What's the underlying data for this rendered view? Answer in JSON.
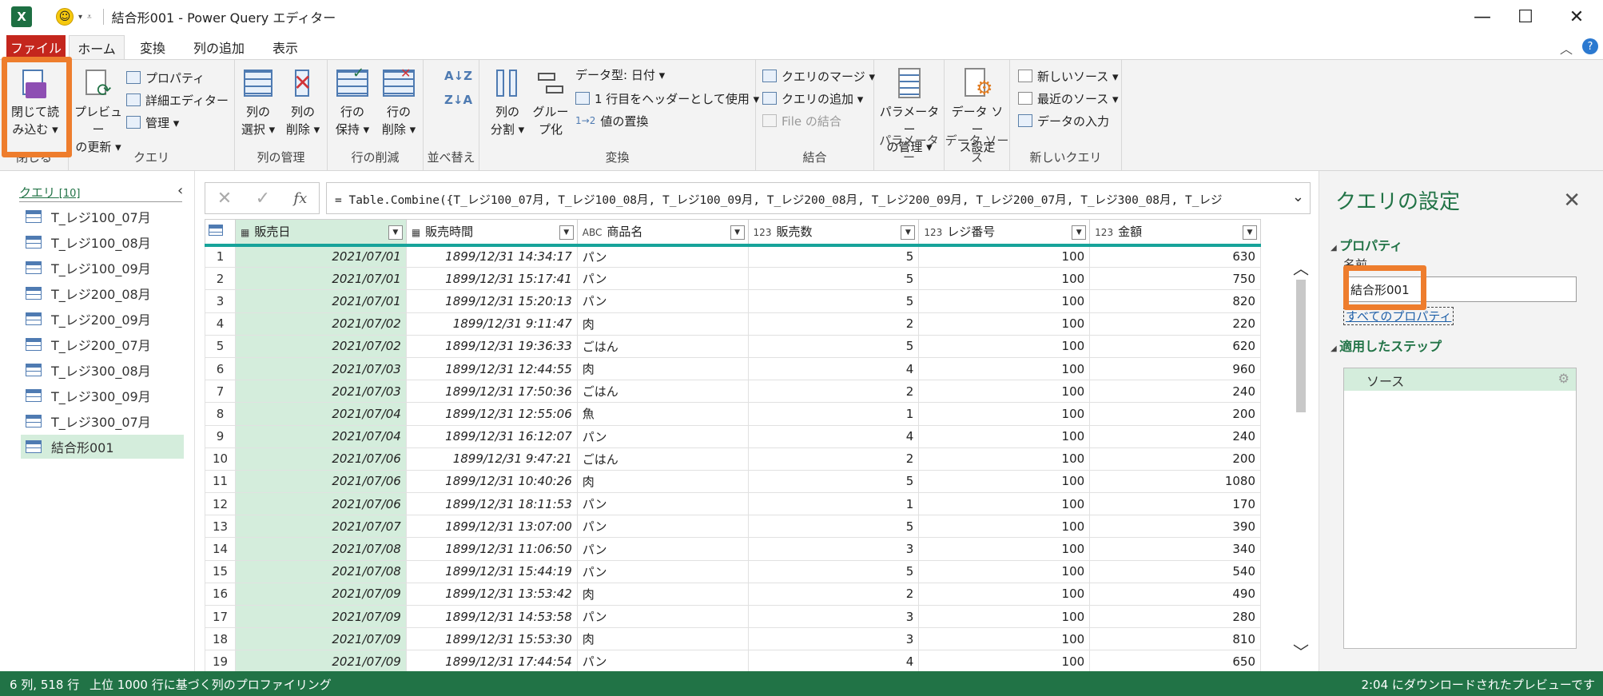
{
  "app": {
    "window_title": "結合形001 - Power Query エディター",
    "app_icon": "X"
  },
  "tabs": [
    {
      "label": "ファイル"
    },
    {
      "label": "ホーム"
    },
    {
      "label": "変換"
    },
    {
      "label": "列の追加"
    },
    {
      "label": "表示"
    }
  ],
  "ribbon": {
    "close_group": {
      "label": "閉じる",
      "close_load_line1": "閉じて読",
      "close_load_line2": "み込む ▾"
    },
    "query_group": {
      "label": "クエリ",
      "preview_line1": "プレビュー",
      "preview_line2": "の更新 ▾",
      "properties": "プロパティ",
      "advanced_editor": "詳細エディター",
      "manage": "管理 ▾"
    },
    "columns_group": {
      "label": "列の管理",
      "choose_line1": "列の",
      "choose_line2": "選択 ▾",
      "remove_line1": "列の",
      "remove_line2": "削除 ▾"
    },
    "rows_group": {
      "label": "行の削減",
      "keep_line1": "行の",
      "keep_line2": "保持 ▾",
      "remove_line1": "行の",
      "remove_line2": "削除 ▾"
    },
    "sort_group": {
      "label": "並べ替え"
    },
    "transform_group": {
      "label": "変換",
      "split_line1": "列の",
      "split_line2": "分割 ▾",
      "group_line1": "グルー",
      "group_line2": "プ化",
      "data_type": "データ型: 日付 ▾",
      "first_row_header": "1 行目をヘッダーとして使用 ▾",
      "replace_values": "値の置換"
    },
    "combine_group": {
      "label": "結合",
      "merge": "クエリのマージ ▾",
      "append": "クエリの追加 ▾",
      "combine_files": "File の結合"
    },
    "params_group": {
      "label": "パラメーター",
      "manage_line1": "パラメーター",
      "manage_line2": "の管理 ▾"
    },
    "datasource_group": {
      "label": "データ ソース",
      "settings_line1": "データ ソー",
      "settings_line2": "ス設定"
    },
    "newquery_group": {
      "label": "新しいクエリ",
      "new_source": "新しいソース ▾",
      "recent_source": "最近のソース ▾",
      "enter_data": "データの入力"
    }
  },
  "queries": {
    "header": "クエリ",
    "count": "[10]",
    "items": [
      {
        "label": "T_レジ100_07月"
      },
      {
        "label": "T_レジ100_08月"
      },
      {
        "label": "T_レジ100_09月"
      },
      {
        "label": "T_レジ200_08月"
      },
      {
        "label": "T_レジ200_09月"
      },
      {
        "label": "T_レジ200_07月"
      },
      {
        "label": "T_レジ300_08月"
      },
      {
        "label": "T_レジ300_09月"
      },
      {
        "label": "T_レジ300_07月"
      },
      {
        "label": "結合形001"
      }
    ]
  },
  "formula_bar": {
    "fx": "fx",
    "formula": "= Table.Combine({T_レジ100_07月, T_レジ100_08月, T_レジ100_09月, T_レジ200_08月, T_レジ200_09月, T_レジ200_07月, T_レジ300_08月, T_レジ"
  },
  "grid": {
    "columns": [
      {
        "type": "",
        "name": "販売日"
      },
      {
        "type": "",
        "name": "販売時間"
      },
      {
        "type": "ABC",
        "name": "商品名"
      },
      {
        "type": "123",
        "name": "販売数"
      },
      {
        "type": "123",
        "name": "レジ番号"
      },
      {
        "type": "123",
        "name": "金額"
      }
    ],
    "rows": [
      [
        "1",
        "2021/07/01",
        "1899/12/31 14:34:17",
        "パン",
        "5",
        "100",
        "630"
      ],
      [
        "2",
        "2021/07/01",
        "1899/12/31 15:17:41",
        "パン",
        "5",
        "100",
        "750"
      ],
      [
        "3",
        "2021/07/01",
        "1899/12/31 15:20:13",
        "パン",
        "5",
        "100",
        "820"
      ],
      [
        "4",
        "2021/07/02",
        "1899/12/31 9:11:47",
        "肉",
        "2",
        "100",
        "220"
      ],
      [
        "5",
        "2021/07/02",
        "1899/12/31 19:36:33",
        "ごはん",
        "5",
        "100",
        "620"
      ],
      [
        "6",
        "2021/07/03",
        "1899/12/31 12:44:55",
        "肉",
        "4",
        "100",
        "960"
      ],
      [
        "7",
        "2021/07/03",
        "1899/12/31 17:50:36",
        "ごはん",
        "2",
        "100",
        "240"
      ],
      [
        "8",
        "2021/07/04",
        "1899/12/31 12:55:06",
        "魚",
        "1",
        "100",
        "200"
      ],
      [
        "9",
        "2021/07/04",
        "1899/12/31 16:12:07",
        "パン",
        "4",
        "100",
        "240"
      ],
      [
        "10",
        "2021/07/06",
        "1899/12/31 9:47:21",
        "ごはん",
        "2",
        "100",
        "200"
      ],
      [
        "11",
        "2021/07/06",
        "1899/12/31 10:40:26",
        "肉",
        "5",
        "100",
        "1080"
      ],
      [
        "12",
        "2021/07/06",
        "1899/12/31 18:11:53",
        "パン",
        "1",
        "100",
        "170"
      ],
      [
        "13",
        "2021/07/07",
        "1899/12/31 13:07:00",
        "パン",
        "5",
        "100",
        "390"
      ],
      [
        "14",
        "2021/07/08",
        "1899/12/31 11:06:50",
        "パン",
        "3",
        "100",
        "340"
      ],
      [
        "15",
        "2021/07/08",
        "1899/12/31 15:44:19",
        "パン",
        "5",
        "100",
        "540"
      ],
      [
        "16",
        "2021/07/09",
        "1899/12/31 13:53:42",
        "肉",
        "2",
        "100",
        "490"
      ],
      [
        "17",
        "2021/07/09",
        "1899/12/31 14:53:58",
        "パン",
        "3",
        "100",
        "280"
      ],
      [
        "18",
        "2021/07/09",
        "1899/12/31 15:53:30",
        "肉",
        "3",
        "100",
        "810"
      ],
      [
        "19",
        "2021/07/09",
        "1899/12/31 17:44:54",
        "パン",
        "4",
        "100",
        "650"
      ]
    ]
  },
  "settings": {
    "title": "クエリの設定",
    "properties_header": "プロパティ",
    "name_label": "名前",
    "name_value": "結合形001",
    "all_properties": "すべてのプロパティ",
    "applied_steps_header": "適用したステップ",
    "steps": [
      {
        "label": "ソース"
      }
    ]
  },
  "status": {
    "left": "6 列, 518 行",
    "middle": "上位 1000 行に基づく列のプロファイリング",
    "right": "2:04 にダウンロードされたプレビューです"
  },
  "colors": {
    "accent": "#217346",
    "highlight": "#ee7d2d",
    "file_tab": "#c4261d",
    "selected": "#d4eddc"
  }
}
